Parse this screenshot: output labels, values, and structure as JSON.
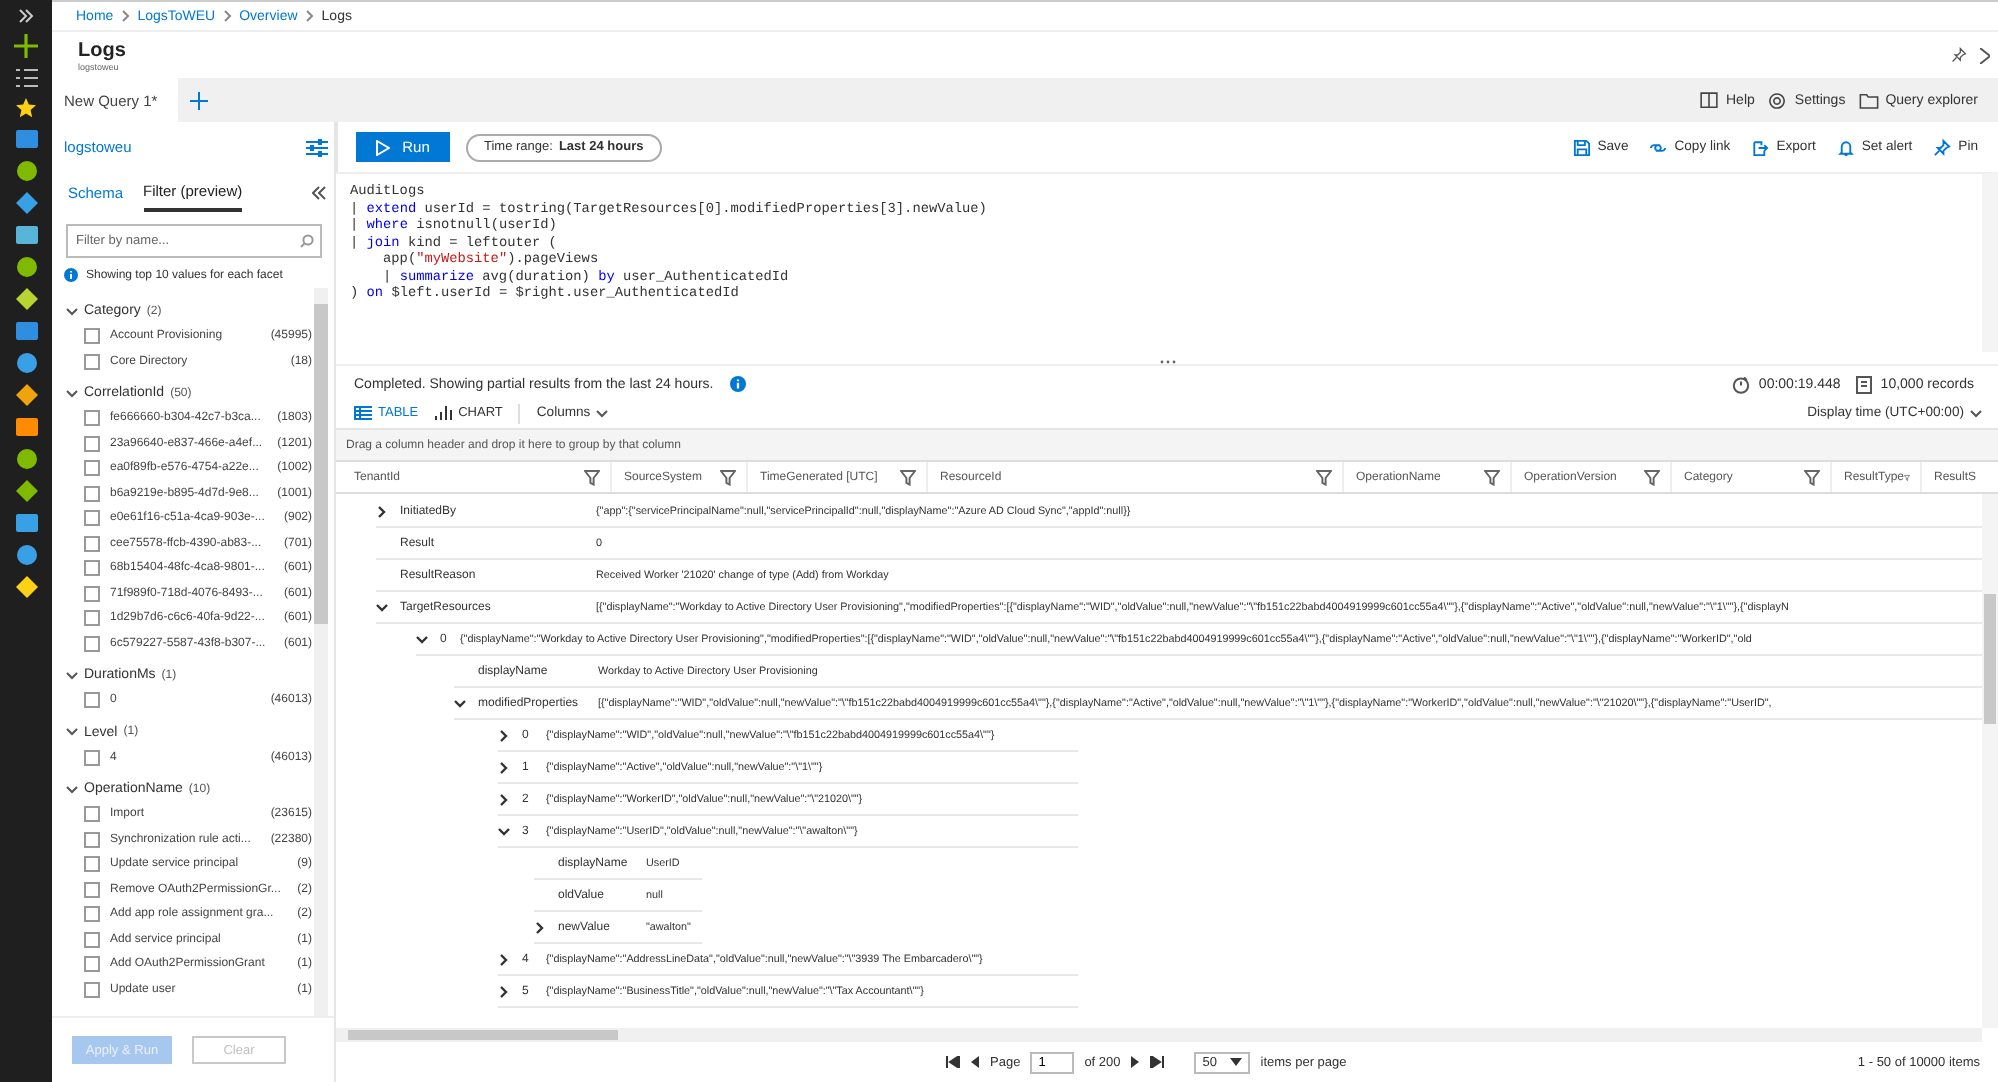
{
  "breadcrumb": [
    {
      "label": "Home",
      "current": false
    },
    {
      "label": "LogsToWEU",
      "current": false
    },
    {
      "label": "Overview",
      "current": false
    },
    {
      "label": "Logs",
      "current": true
    }
  ],
  "blade": {
    "title": "Logs",
    "subtitle": "logstoweu"
  },
  "query_tabs": [
    {
      "label": "New Query 1*",
      "selected": true
    }
  ],
  "header_actions": [
    "Help",
    "Settings",
    "Query explorer"
  ],
  "left_panel": {
    "workspace": "logstoweu",
    "tabs": [
      {
        "label": "Schema",
        "selected": false
      },
      {
        "label": "Filter (preview)",
        "selected": true
      }
    ],
    "filter": {
      "placeholder": "Filter by name..."
    },
    "info": "Showing top 10 values for each facet",
    "facets": [
      {
        "name": "Category",
        "count": "(2)",
        "expanded": true,
        "items": [
          {
            "label": "Account Provisioning",
            "count": "(45995)",
            "checked": false
          },
          {
            "label": "Core Directory",
            "count": "(18)",
            "checked": false
          }
        ]
      },
      {
        "name": "CorrelationId",
        "count": "(50)",
        "expanded": true,
        "items": [
          {
            "label": "fe666660-b304-42c7-b3ca...",
            "count": "(1803)",
            "checked": false
          },
          {
            "label": "23a96640-e837-466e-a4ef...",
            "count": "(1201)",
            "checked": false
          },
          {
            "label": "ea0f89fb-e576-4754-a22e...",
            "count": "(1002)",
            "checked": false
          },
          {
            "label": "b6a9219e-b895-4d7d-9e8...",
            "count": "(1001)",
            "checked": false
          },
          {
            "label": "e0e61f16-c51a-4ca9-903e-...",
            "count": "(902)",
            "checked": false
          },
          {
            "label": "cee75578-ffcb-4390-ab83-...",
            "count": "(701)",
            "checked": false
          },
          {
            "label": "68b15404-48fc-4ca8-9801-...",
            "count": "(601)",
            "checked": false
          },
          {
            "label": "71f989f0-718d-4076-8493-...",
            "count": "(601)",
            "checked": false
          },
          {
            "label": "1d29b7d6-c6c6-40fa-9d22-...",
            "count": "(601)",
            "checked": false
          },
          {
            "label": "6c579227-5587-43f8-b307-...",
            "count": "(601)",
            "checked": false
          }
        ]
      },
      {
        "name": "DurationMs",
        "count": "(1)",
        "expanded": true,
        "items": [
          {
            "label": "0",
            "count": "(46013)",
            "checked": false
          }
        ]
      },
      {
        "name": "Level",
        "count": "(1)",
        "expanded": true,
        "items": [
          {
            "label": "4",
            "count": "(46013)",
            "checked": false
          }
        ]
      },
      {
        "name": "OperationName",
        "count": "(10)",
        "expanded": true,
        "items": [
          {
            "label": "Import",
            "count": "(23615)",
            "checked": false
          },
          {
            "label": "Synchronization rule acti...",
            "count": "(22380)",
            "checked": false
          },
          {
            "label": "Update service principal",
            "count": "(9)",
            "checked": false
          },
          {
            "label": "Remove OAuth2PermissionGr...",
            "count": "(2)",
            "checked": false
          },
          {
            "label": "Add app role assignment gra...",
            "count": "(2)",
            "checked": false
          },
          {
            "label": "Add service principal",
            "count": "(1)",
            "checked": false
          },
          {
            "label": "Add OAuth2PermissionGrant",
            "count": "(1)",
            "checked": false
          },
          {
            "label": "Update user",
            "count": "(1)",
            "checked": false
          }
        ]
      }
    ],
    "buttons": [
      {
        "label": "Apply & Run",
        "kind": "primary",
        "disabled": true
      },
      {
        "label": "Clear",
        "kind": "secondary",
        "disabled": true
      }
    ]
  },
  "toolbar": {
    "run": "Run",
    "time_range": "Time range: **Last 24 hours**",
    "actions": [
      "Save",
      "Copy link",
      "Export",
      "Set alert",
      "Pin"
    ]
  },
  "query": [
    [
      {
        "text": "AuditLogs",
        "kind": "plain"
      }
    ],
    [
      {
        "text": "| ",
        "kind": "plain"
      },
      {
        "text": "extend",
        "kind": "keyword"
      },
      {
        "text": " userId = tostring(TargetResources[0].modifiedProperties[3].newValue)",
        "kind": "plain"
      }
    ],
    [
      {
        "text": "| ",
        "kind": "plain"
      },
      {
        "text": "where",
        "kind": "keyword"
      },
      {
        "text": " isnotnull(userId)",
        "kind": "plain"
      }
    ],
    [
      {
        "text": "| ",
        "kind": "plain"
      },
      {
        "text": "join",
        "kind": "keyword"
      },
      {
        "text": " kind = leftouter (",
        "kind": "plain"
      }
    ],
    [
      {
        "text": "    app(",
        "kind": "plain"
      },
      {
        "text": "\"myWebsite\"",
        "kind": "string"
      },
      {
        "text": ").pageViews",
        "kind": "plain"
      }
    ],
    [
      {
        "text": "    | ",
        "kind": "plain"
      },
      {
        "text": "summarize",
        "kind": "keyword"
      },
      {
        "text": " avg(duration) ",
        "kind": "plain"
      },
      {
        "text": "by",
        "kind": "keyword"
      },
      {
        "text": " user_AuthenticatedId",
        "kind": "plain"
      }
    ],
    [
      {
        "text": ") ",
        "kind": "plain"
      },
      {
        "text": "on",
        "kind": "keyword"
      },
      {
        "text": " $left.userId = $right.user_AuthenticatedId",
        "kind": "plain"
      }
    ]
  ],
  "status": {
    "message": "Completed. Showing partial results from the last 24 hours.",
    "duration": "00:00:19.448",
    "records": "10,000 records"
  },
  "view_tabs": [
    {
      "label": "TABLE",
      "selected": true
    },
    {
      "label": "CHART",
      "selected": false
    }
  ],
  "columns_button": "Columns",
  "display_time": "Display time (UTC+00:00)",
  "group_hint": "Drag a column header and drop it here to group by that column",
  "table": {
    "columns": [
      "TenantId",
      "SourceSystem",
      "TimeGenerated [UTC]",
      "ResourceId",
      "OperationName",
      "OperationVersion",
      "Category",
      "ResultType",
      "ResultS"
    ],
    "rows": [
      {
        "key": "InitiatedBy",
        "value": "{\"app\":{\"servicePrincipalName\":null,\"servicePrincipalId\":null,\"displayName\":\"Azure AD Cloud Sync\",\"appId\":null}}",
        "expanded": false
      },
      {
        "key": "Result",
        "value": "0"
      },
      {
        "key": "ResultReason",
        "value": "Received Worker '21020' change of type (Add) from Workday"
      },
      {
        "key": "TargetResources",
        "value": "[{\"displayName\":\"Workday to Active Directory User Provisioning\",\"modifiedProperties\":[{\"displayName\":\"WID\",\"oldValue\":null,\"newValue\":\"\\\"fb151c22babd4004919999c601cc55a4\\\"\"},{\"displayName\":\"Active\",\"oldValue\":null,\"newValue\":\"\\\"1\\\"\"},{\"displayN",
        "expanded": true,
        "children": [
          {
            "key": "0",
            "value": "{\"displayName\":\"Workday to Active Directory User Provisioning\",\"modifiedProperties\":[{\"displayName\":\"WID\",\"oldValue\":null,\"newValue\":\"\\\"fb151c22babd4004919999c601cc55a4\\\"\"},{\"displayName\":\"Active\",\"oldValue\":null,\"newValue\":\"\\\"1\\\"\"},{\"displayName\":\"WorkerID\",\"old",
            "expanded": true,
            "children": [
              {
                "key": "displayName",
                "value": "Workday to Active Directory User Provisioning"
              },
              {
                "key": "modifiedProperties",
                "value": "[{\"displayName\":\"WID\",\"oldValue\":null,\"newValue\":\"\\\"fb151c22babd4004919999c601cc55a4\\\"\"},{\"displayName\":\"Active\",\"oldValue\":null,\"newValue\":\"\\\"1\\\"\"},{\"displayName\":\"WorkerID\",\"oldValue\":null,\"newValue\":\"\\\"21020\\\"\"},{\"displayName\":\"UserID\",",
                "expanded": true,
                "children": [
                  {
                    "key": "0",
                    "value": "{\"displayName\":\"WID\",\"oldValue\":null,\"newValue\":\"\\\"fb151c22babd4004919999c601cc55a4\\\"\"}",
                    "expanded": false
                  },
                  {
                    "key": "1",
                    "value": "{\"displayName\":\"Active\",\"oldValue\":null,\"newValue\":\"\\\"1\\\"\"}",
                    "expanded": false
                  },
                  {
                    "key": "2",
                    "value": "{\"displayName\":\"WorkerID\",\"oldValue\":null,\"newValue\":\"\\\"21020\\\"\"}",
                    "expanded": false
                  },
                  {
                    "key": "3",
                    "value": "{\"displayName\":\"UserID\",\"oldValue\":null,\"newValue\":\"\\\"awalton\\\"\"}",
                    "expanded": true,
                    "children": [
                      {
                        "key": "displayName",
                        "value": "UserID"
                      },
                      {
                        "key": "oldValue",
                        "value": "null"
                      },
                      {
                        "key": "newValue",
                        "value": "\"awalton\"",
                        "expanded": false
                      }
                    ]
                  },
                  {
                    "key": "4",
                    "value": "{\"displayName\":\"AddressLineData\",\"oldValue\":null,\"newValue\":\"\\\"3939 The Embarcadero\\\"\"}",
                    "expanded": false
                  },
                  {
                    "key": "5",
                    "value": "{\"displayName\":\"BusinessTitle\",\"oldValue\":null,\"newValue\":\"\\\"Tax Accountant\\\"\"}",
                    "expanded": false
                  }
                ]
              }
            ]
          }
        ]
      }
    ]
  },
  "pager": {
    "page_label": "Page",
    "page": "1",
    "of": "of 200",
    "page_size": "50",
    "per_page": "items per page",
    "summary": "1 - 50 of 10000 items"
  }
}
